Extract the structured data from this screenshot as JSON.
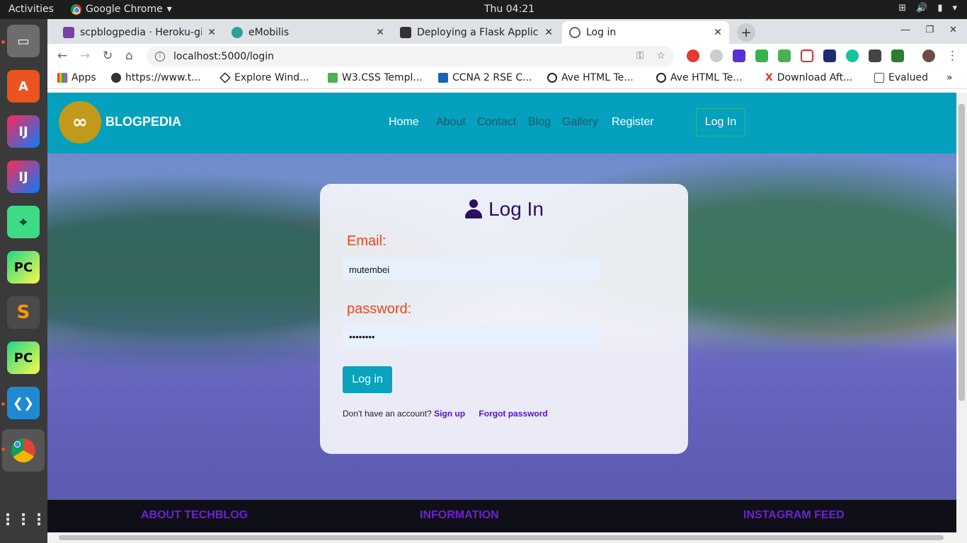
{
  "system": {
    "activities": "Activities",
    "app_name": "Google Chrome",
    "clock": "Thu 04:21"
  },
  "tabs": [
    {
      "title": "scpblogpedia · Heroku-git",
      "icon_color": "#7b3fa8"
    },
    {
      "title": "eMobilis",
      "icon_color": "#2aa198"
    },
    {
      "title": "Deploying a Flask Applicat",
      "icon_color": "#333333"
    },
    {
      "title": "Log in",
      "icon_color": "#5f6368",
      "active": true
    }
  ],
  "address_bar": {
    "url": "localhost:5000/login"
  },
  "bookmarks": [
    {
      "label": "Apps",
      "icon_color": "#e94235"
    },
    {
      "label": "https://www.t...",
      "icon_color": "#333333"
    },
    {
      "label": "Explore Wind...",
      "icon_color": "#333333"
    },
    {
      "label": "W3.CSS Templ...",
      "icon_color": "#4caf50"
    },
    {
      "label": "CCNA 2 RSE C...",
      "icon_color": "#1565c0"
    },
    {
      "label": "Ave HTML Te...",
      "icon_color": "#222222"
    },
    {
      "label": "Ave HTML Te...",
      "icon_color": "#222222"
    },
    {
      "label": "Download Aft...",
      "icon_color": "#e53935"
    },
    {
      "label": "Evalued",
      "icon_color": "#555555"
    }
  ],
  "site": {
    "brand": "BLOGPEDIA",
    "nav": [
      "Home",
      "About",
      "Contact",
      "Blog",
      "Gallery",
      "Register"
    ],
    "nav_login": "Log In",
    "accent": "#04a0bd"
  },
  "login_card": {
    "title": "Log In",
    "email_label": "Email:",
    "email_value": "mutembei",
    "password_label": "password:",
    "password_value": "••••••••",
    "submit_label": "Log in",
    "no_account_text": "Don't have an account?",
    "signup_link": "Sign up",
    "forgot_link": "Forgot password"
  },
  "footer": {
    "headings": [
      "ABOUT TECHBLOG",
      "INFORMATION",
      "INSTAGRAM FEED"
    ]
  }
}
